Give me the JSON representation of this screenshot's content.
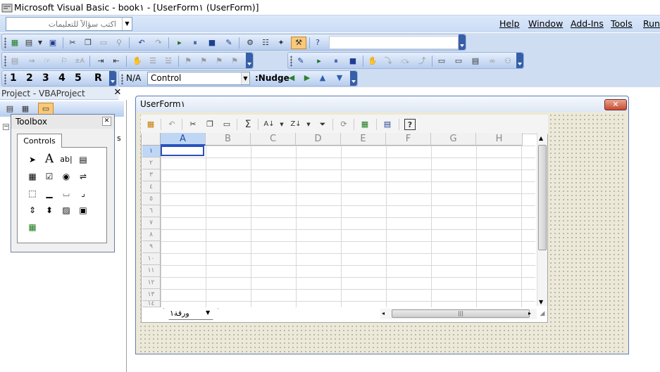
{
  "window": {
    "title": "Microsoft Visual Basic - book١ - [UserForm١ (UserForm)]"
  },
  "help_box": {
    "placeholder": "اكتب سؤالاً للتعليمات",
    "value": ""
  },
  "menu": [
    {
      "label": "Help"
    },
    {
      "label": "Window"
    },
    {
      "label": "Add-Ins"
    },
    {
      "label": "Tools"
    },
    {
      "label": "Run"
    }
  ],
  "format_bar": {
    "digits": [
      "1",
      "2",
      "3",
      "4",
      "5",
      "R"
    ],
    "na_label": "N/A",
    "control_select": "Control",
    "nudge_label": ":Nudge"
  },
  "project": {
    "title": "Project - VBAProject"
  },
  "toolbox": {
    "title": "Toolbox",
    "tab": "Controls"
  },
  "userform": {
    "title": "UserForm١"
  },
  "spreadsheet": {
    "columns": [
      "A",
      "B",
      "C",
      "D",
      "E",
      "F",
      "G",
      "H"
    ],
    "rows": [
      "١",
      "٢",
      "٣",
      "٤",
      "٥",
      "٦",
      "٧",
      "٨",
      "٩",
      "١٠",
      "١١",
      "١٢",
      "١٣",
      "١٤"
    ],
    "sheet_tab": "ورقة١",
    "sum_symbol": "Σ"
  },
  "colors": {
    "accent": "#365fa8",
    "active_cell": "#2a52be",
    "close": "#c74a2c"
  }
}
